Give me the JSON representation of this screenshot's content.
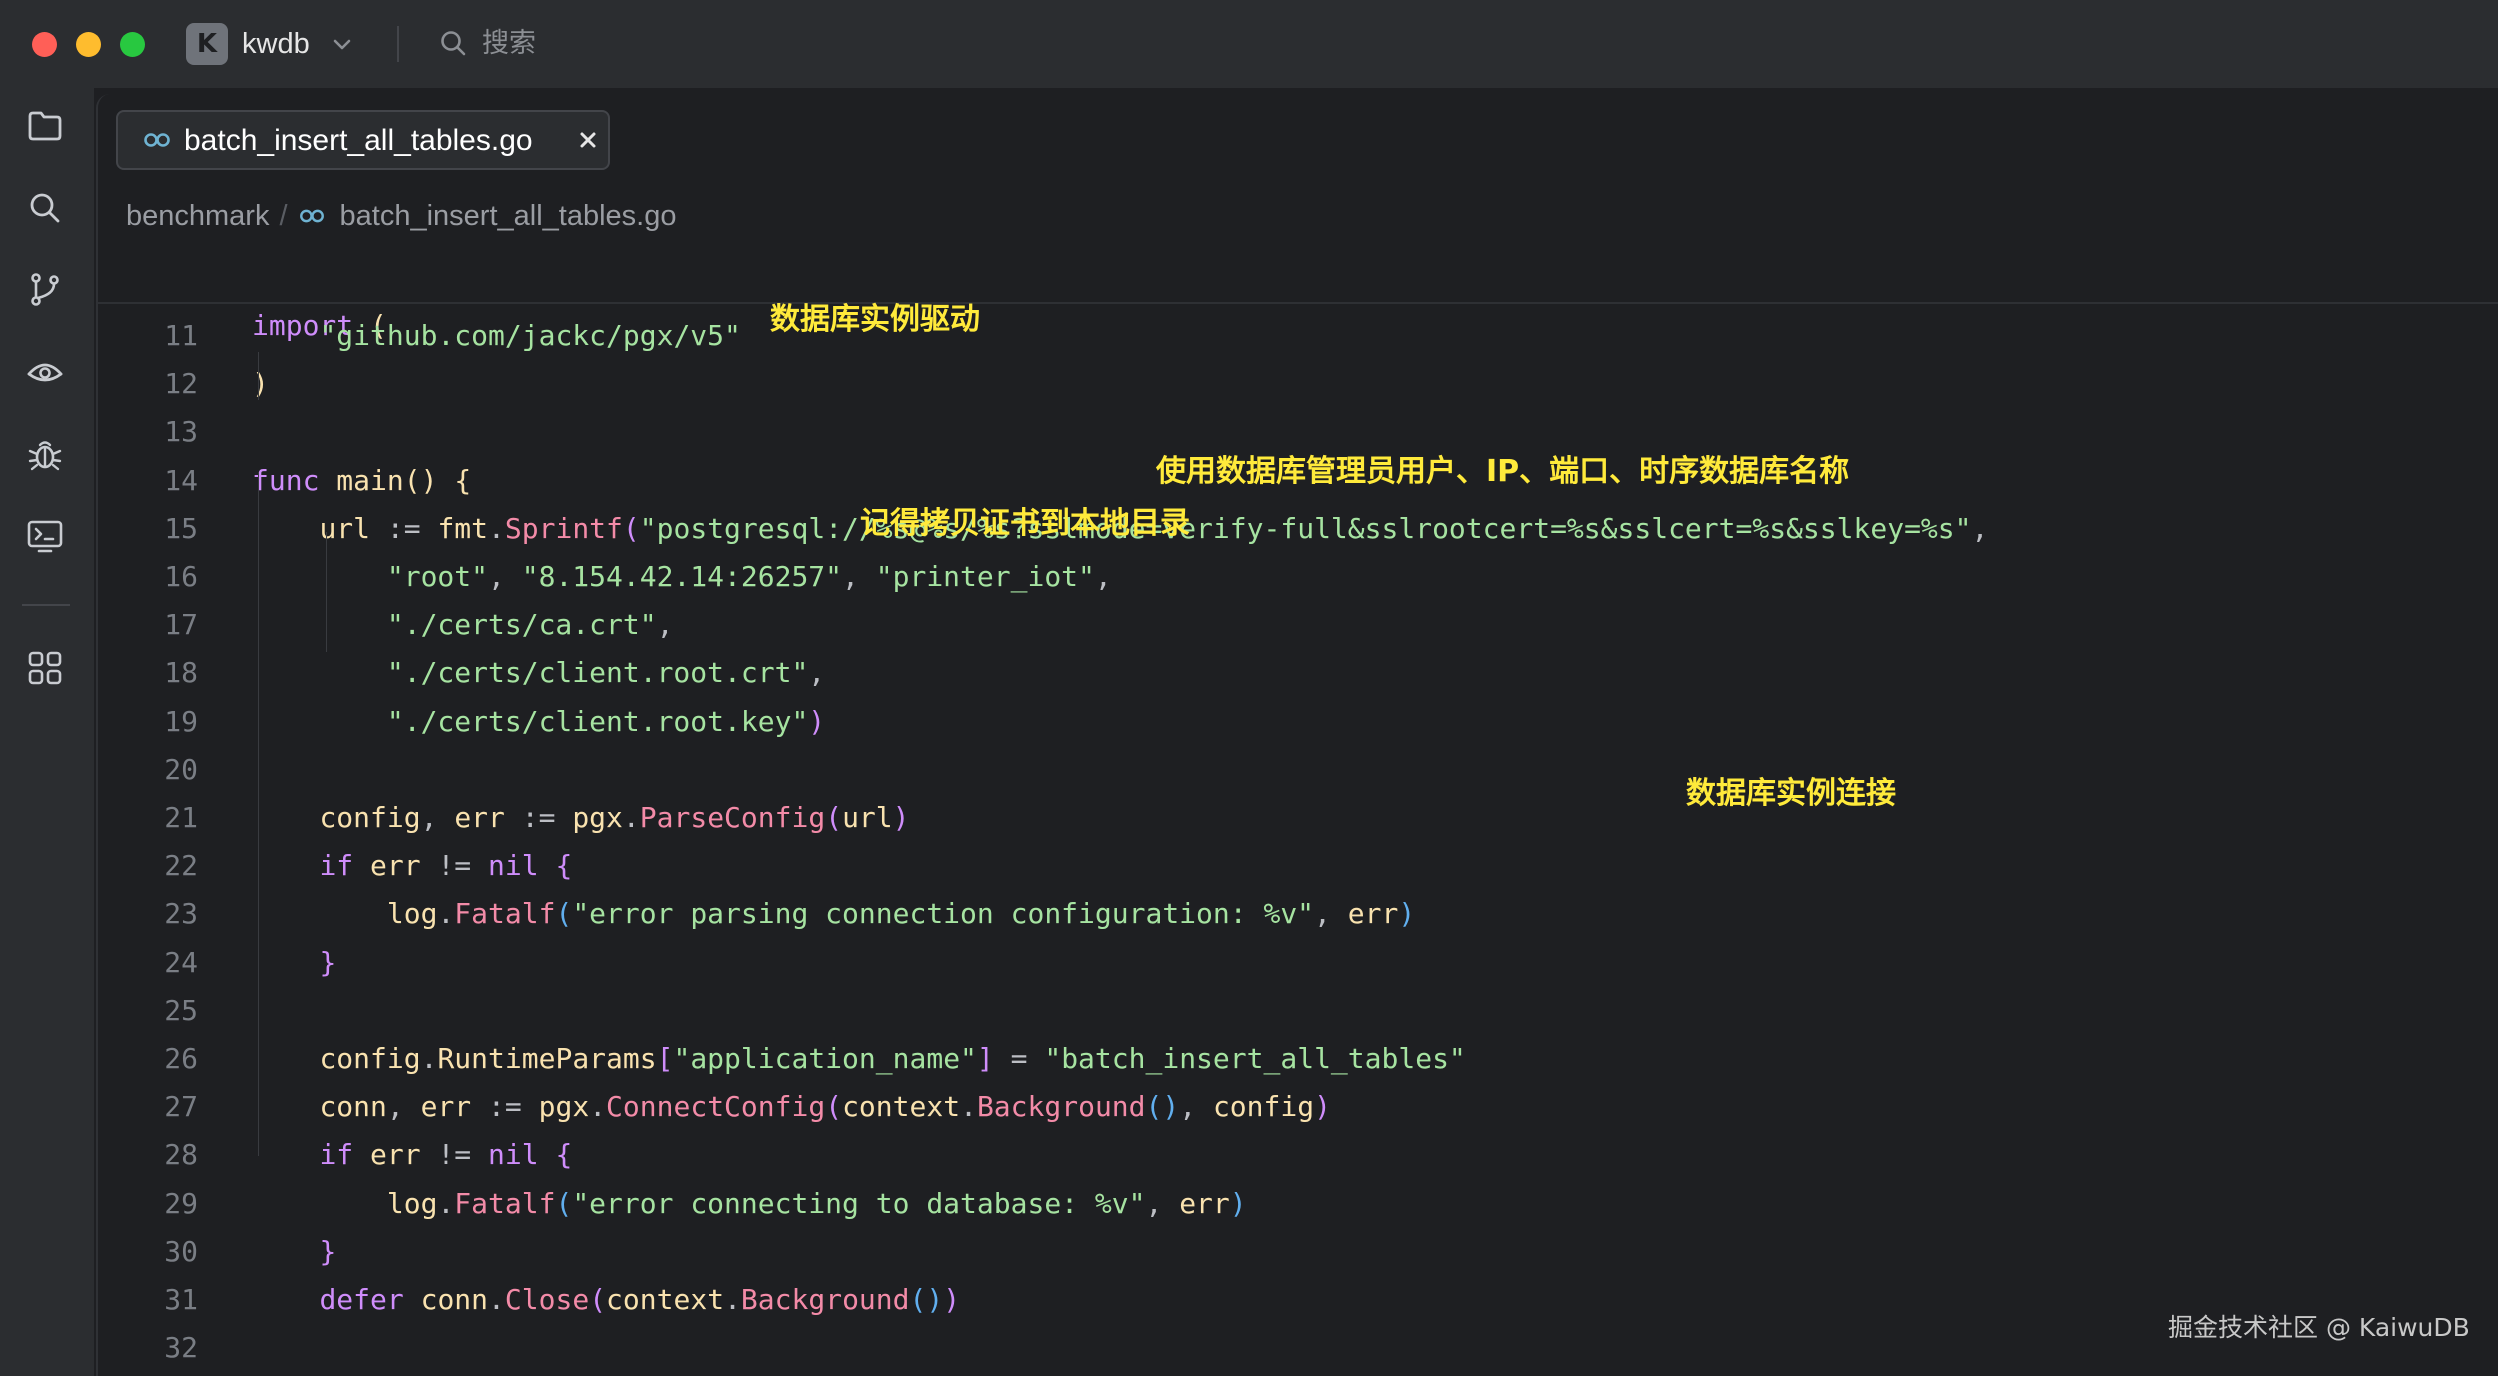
{
  "titlebar": {
    "project_initial": "K",
    "project_name": "kwdb",
    "search_label": "搜索"
  },
  "activity_bar": {
    "items": [
      "folder-icon",
      "search-icon",
      "git-branch-icon",
      "eye-icon",
      "bug-icon",
      "terminal-icon",
      "apps-grid-icon"
    ]
  },
  "tab": {
    "title": "batch_insert_all_tables.go"
  },
  "breadcrumb": {
    "folder": "benchmark",
    "separator": "/",
    "file": "batch_insert_all_tables.go"
  },
  "sticky": {
    "keyword": "import",
    "paren": " ("
  },
  "code": {
    "lines": [
      {
        "n": "11",
        "tokens": [
          [
            "    ",
            "pl"
          ],
          [
            "\"github.com/jackc/pgx/v5\"",
            "str"
          ]
        ]
      },
      {
        "n": "12",
        "tokens": [
          [
            ")",
            "bracket1"
          ]
        ]
      },
      {
        "n": "13",
        "tokens": []
      },
      {
        "n": "14",
        "tokens": [
          [
            "func",
            "kw"
          ],
          [
            " ",
            "pl"
          ],
          [
            "main",
            "id"
          ],
          [
            "()",
            "bracket1"
          ],
          [
            " ",
            "pl"
          ],
          [
            "{",
            "bracket1"
          ]
        ]
      },
      {
        "n": "15",
        "tokens": [
          [
            "    ",
            "pl"
          ],
          [
            "url",
            "id"
          ],
          [
            " := ",
            "pl"
          ],
          [
            "fmt",
            "id"
          ],
          [
            ".",
            "pl"
          ],
          [
            "Sprintf",
            "fn"
          ],
          [
            "(",
            "bracket2"
          ],
          [
            "\"postgresql://%s@%s/%s?sslmode=verify-full&sslrootcert=%s&sslcert=%s&sslkey=%s\"",
            "str"
          ],
          [
            ",",
            "pl"
          ]
        ]
      },
      {
        "n": "16",
        "tokens": [
          [
            "        ",
            "pl"
          ],
          [
            "\"root\"",
            "str"
          ],
          [
            ", ",
            "pl"
          ],
          [
            "\"8.154.42.14:26257\"",
            "str"
          ],
          [
            ", ",
            "pl"
          ],
          [
            "\"printer_iot\"",
            "str"
          ],
          [
            ",",
            "pl"
          ]
        ]
      },
      {
        "n": "17",
        "tokens": [
          [
            "        ",
            "pl"
          ],
          [
            "\"./certs/ca.crt\"",
            "str"
          ],
          [
            ",",
            "pl"
          ]
        ]
      },
      {
        "n": "18",
        "tokens": [
          [
            "        ",
            "pl"
          ],
          [
            "\"./certs/client.root.crt\"",
            "str"
          ],
          [
            ",",
            "pl"
          ]
        ]
      },
      {
        "n": "19",
        "tokens": [
          [
            "        ",
            "pl"
          ],
          [
            "\"./certs/client.root.key\"",
            "str"
          ],
          [
            ")",
            "bracket2"
          ]
        ]
      },
      {
        "n": "20",
        "tokens": []
      },
      {
        "n": "21",
        "tokens": [
          [
            "    ",
            "pl"
          ],
          [
            "config",
            "id"
          ],
          [
            ", ",
            "pl"
          ],
          [
            "err",
            "id"
          ],
          [
            " := ",
            "pl"
          ],
          [
            "pgx",
            "id"
          ],
          [
            ".",
            "pl"
          ],
          [
            "ParseConfig",
            "fn"
          ],
          [
            "(",
            "bracket2"
          ],
          [
            "url",
            "id"
          ],
          [
            ")",
            "bracket2"
          ]
        ]
      },
      {
        "n": "22",
        "tokens": [
          [
            "    ",
            "pl"
          ],
          [
            "if",
            "kw"
          ],
          [
            " ",
            "pl"
          ],
          [
            "err",
            "id"
          ],
          [
            " != ",
            "pl"
          ],
          [
            "nil",
            "kw"
          ],
          [
            " ",
            "pl"
          ],
          [
            "{",
            "bracket2"
          ]
        ]
      },
      {
        "n": "23",
        "tokens": [
          [
            "        ",
            "pl"
          ],
          [
            "log",
            "id"
          ],
          [
            ".",
            "pl"
          ],
          [
            "Fatalf",
            "fn"
          ],
          [
            "(",
            "bracket3"
          ],
          [
            "\"error parsing connection configuration: %v\"",
            "str"
          ],
          [
            ", ",
            "pl"
          ],
          [
            "err",
            "id"
          ],
          [
            ")",
            "bracket3"
          ]
        ]
      },
      {
        "n": "24",
        "tokens": [
          [
            "    ",
            "pl"
          ],
          [
            "}",
            "bracket2"
          ]
        ]
      },
      {
        "n": "25",
        "tokens": []
      },
      {
        "n": "26",
        "tokens": [
          [
            "    ",
            "pl"
          ],
          [
            "config",
            "id"
          ],
          [
            ".",
            "pl"
          ],
          [
            "RuntimeParams",
            "id"
          ],
          [
            "[",
            "bracket2"
          ],
          [
            "\"application_name\"",
            "str"
          ],
          [
            "]",
            "bracket2"
          ],
          [
            " = ",
            "pl"
          ],
          [
            "\"batch_insert_all_tables\"",
            "str"
          ]
        ]
      },
      {
        "n": "27",
        "tokens": [
          [
            "    ",
            "pl"
          ],
          [
            "conn",
            "id"
          ],
          [
            ", ",
            "pl"
          ],
          [
            "err",
            "id"
          ],
          [
            " := ",
            "pl"
          ],
          [
            "pgx",
            "id"
          ],
          [
            ".",
            "pl"
          ],
          [
            "ConnectConfig",
            "fn"
          ],
          [
            "(",
            "bracket2"
          ],
          [
            "context",
            "id"
          ],
          [
            ".",
            "pl"
          ],
          [
            "Background",
            "fn"
          ],
          [
            "()",
            "bracket3"
          ],
          [
            ", ",
            "pl"
          ],
          [
            "config",
            "id"
          ],
          [
            ")",
            "bracket2"
          ]
        ]
      },
      {
        "n": "28",
        "tokens": [
          [
            "    ",
            "pl"
          ],
          [
            "if",
            "kw"
          ],
          [
            " ",
            "pl"
          ],
          [
            "err",
            "id"
          ],
          [
            " != ",
            "pl"
          ],
          [
            "nil",
            "kw"
          ],
          [
            " ",
            "pl"
          ],
          [
            "{",
            "bracket2"
          ]
        ]
      },
      {
        "n": "29",
        "tokens": [
          [
            "        ",
            "pl"
          ],
          [
            "log",
            "id"
          ],
          [
            ".",
            "pl"
          ],
          [
            "Fatalf",
            "fn"
          ],
          [
            "(",
            "bracket3"
          ],
          [
            "\"error connecting to database: %v\"",
            "str"
          ],
          [
            ", ",
            "pl"
          ],
          [
            "err",
            "id"
          ],
          [
            ")",
            "bracket3"
          ]
        ]
      },
      {
        "n": "30",
        "tokens": [
          [
            "    ",
            "pl"
          ],
          [
            "}",
            "bracket2"
          ]
        ]
      },
      {
        "n": "31",
        "tokens": [
          [
            "    ",
            "pl"
          ],
          [
            "defer",
            "kw"
          ],
          [
            " ",
            "pl"
          ],
          [
            "conn",
            "id"
          ],
          [
            ".",
            "pl"
          ],
          [
            "Close",
            "fn"
          ],
          [
            "(",
            "bracket2"
          ],
          [
            "context",
            "id"
          ],
          [
            ".",
            "pl"
          ],
          [
            "Background",
            "fn"
          ],
          [
            "()",
            "bracket3"
          ],
          [
            ")",
            "bracket2"
          ]
        ]
      },
      {
        "n": "32",
        "tokens": []
      }
    ]
  },
  "annotations": {
    "driver": "数据库实例驱动",
    "credentials": "使用数据库管理员用户、IP、端口、时序数据库名称",
    "certs": "记得拷贝证书到本地目录",
    "connection": "数据库实例连接"
  },
  "watermark": "掘金技术社区 @ KaiwuDB",
  "colors": {
    "background": "#1e1f22",
    "chrome": "#2b2d30",
    "keyword": "#cf8dfb",
    "string": "#a6e3a1",
    "function": "#f38ba8",
    "identifier": "#f9e2af",
    "annotation": "#ffea3b"
  }
}
